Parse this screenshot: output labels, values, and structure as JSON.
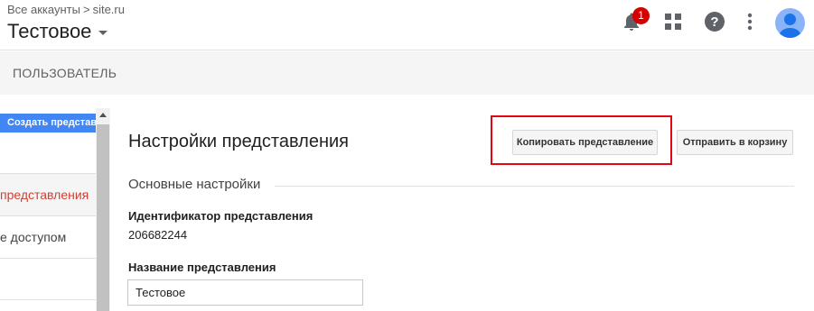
{
  "header": {
    "breadcrumb": [
      "Все аккаунты",
      "site.ru"
    ],
    "breadcrumb_separator": ">",
    "account_name": "Тестовое",
    "notification_count": "1",
    "icons": [
      "bell-icon",
      "apps-grid-icon",
      "help-icon",
      "more-vert-icon",
      "avatar-icon"
    ],
    "badge_color": "#d50000",
    "avatar_color": "#8ab4f8"
  },
  "subbar": {
    "title": "ПОЛЬЗОВАТЕЛЬ"
  },
  "sidebar": {
    "create_button": "Создать представ",
    "items": [
      {
        "label": "представления",
        "active": true
      },
      {
        "label": "е доступом",
        "active": false
      }
    ],
    "accent_color": "#4285f4",
    "active_color": "#d23f31"
  },
  "main": {
    "title": "Настройки представления",
    "copy_button": "Копировать представление",
    "trash_button": "Отправить в корзину",
    "section_title": "Основные настройки",
    "view_id_label": "Идентификатор представления",
    "view_id_value": "206682244",
    "view_name_label": "Название представления",
    "view_name_value": "Тестовое",
    "highlight_color": "#e30613"
  }
}
